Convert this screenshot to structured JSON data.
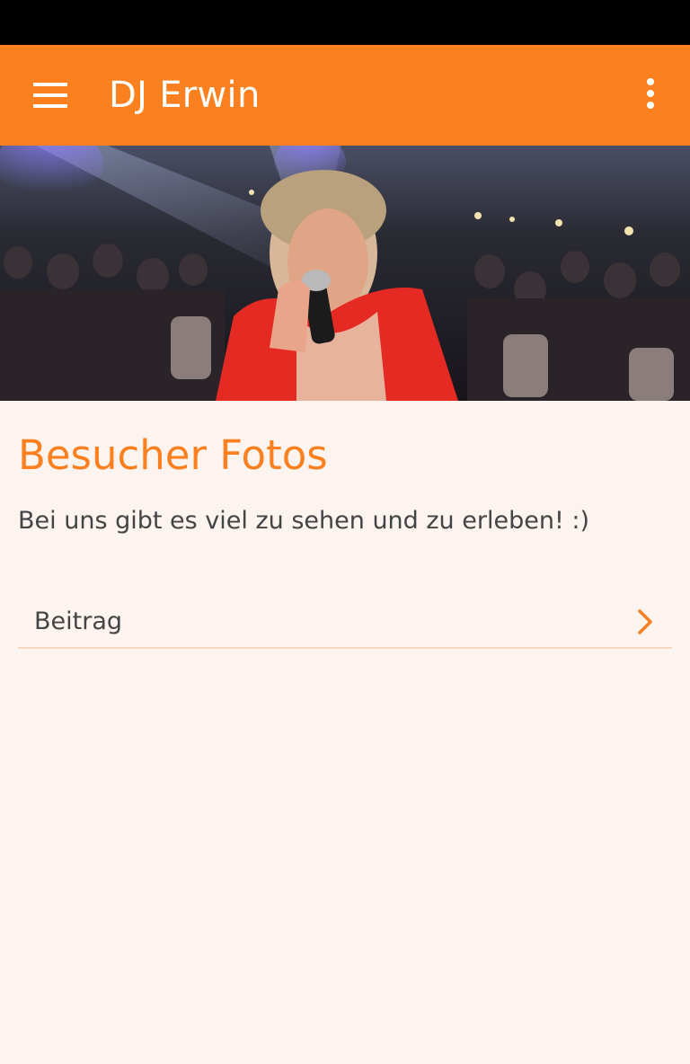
{
  "app_bar": {
    "title": "DJ Erwin",
    "menu_icon": "hamburger-menu-icon",
    "overflow_icon": "more-vertical-icon"
  },
  "hero": {
    "image": "dj-performing-on-stage-photo"
  },
  "content": {
    "title": "Besucher Fotos",
    "subtitle": "Bei uns gibt es viel zu sehen und zu erleben! :)",
    "items": [
      {
        "label": "Beitrag",
        "icon": "chevron-right-icon"
      }
    ]
  },
  "colors": {
    "accent": "#fd8020",
    "background": "#fdf4ef",
    "text": "#444444",
    "divider": "#f7d8c2",
    "status_bar": "#000000"
  }
}
